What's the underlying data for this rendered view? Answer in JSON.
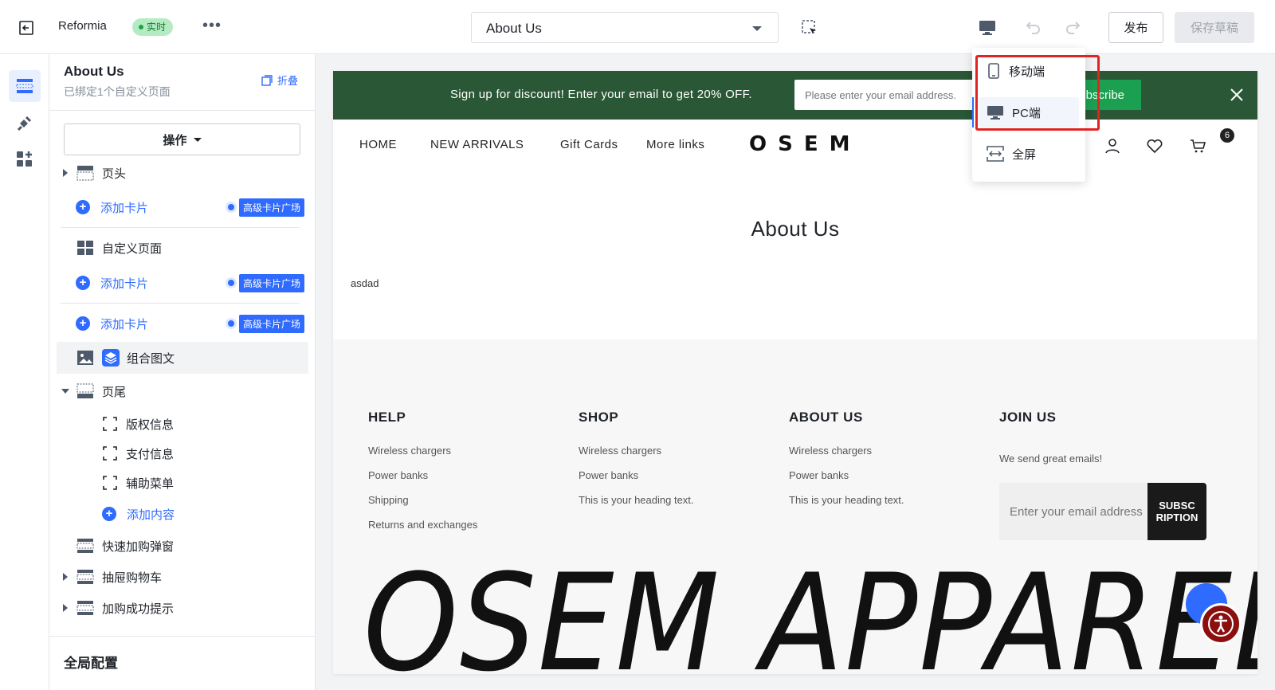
{
  "topbar": {
    "store_name": "Reformia",
    "live_badge": "实时",
    "more": "•••",
    "page_select": "About Us",
    "publish_label": "发布",
    "save_draft_label": "保存草稿"
  },
  "device_menu": {
    "items": [
      {
        "label": "移动端",
        "icon": "mobile-icon"
      },
      {
        "label": "PC端",
        "icon": "desktop-icon",
        "active": true
      },
      {
        "label": "全屏",
        "icon": "fullscreen-icon"
      }
    ]
  },
  "sidebar": {
    "title": "About Us",
    "subtitle": "已绑定1个自定义页面",
    "collapse_label": "折叠",
    "ops_label": "操作",
    "header_label": "页头",
    "add_card": "添加卡片",
    "premium_tag": "高级卡片广场",
    "custom_page": "自定义页面",
    "image_text_combo": "组合图文",
    "footer_label": "页尾",
    "footer_children": [
      "版权信息",
      "支付信息",
      "辅助菜单"
    ],
    "add_content": "添加内容",
    "quick_add_popup": "快速加购弹窗",
    "drawer_cart": "抽屉购物车",
    "add_success_tip": "加购成功提示",
    "global_config": "全局配置"
  },
  "canvas": {
    "promo": {
      "text": "Sign up for discount! Enter your email to get 20% OFF.",
      "placeholder": "Please enter your email address.",
      "button": "Subscribe"
    },
    "nav": {
      "items": [
        "HOME",
        "NEW ARRIVALS",
        "Gift Cards",
        "More links"
      ],
      "logo": "OSEM",
      "cart_count": "6"
    },
    "page_title": "About Us",
    "page_body": "asdad",
    "footer": {
      "columns": [
        {
          "title": "HELP",
          "links": [
            "Wireless chargers",
            "Power banks",
            "Shipping",
            "Returns and exchanges"
          ]
        },
        {
          "title": "SHOP",
          "links": [
            "Wireless chargers",
            "Power banks",
            "This is your heading text."
          ]
        },
        {
          "title": "ABOUT US",
          "links": [
            "Wireless chargers",
            "Power banks",
            "This is your heading text."
          ]
        }
      ],
      "join_title": "JOIN US",
      "join_text": "We send great emails!",
      "join_placeholder": "Enter your email address",
      "join_button": "SUBSCRIPTION",
      "big_brand": "OSEM APPAREL"
    }
  },
  "colors": {
    "accent": "#2f6bff",
    "promo_bg": "#2a5735",
    "highlight": "#e02424"
  }
}
